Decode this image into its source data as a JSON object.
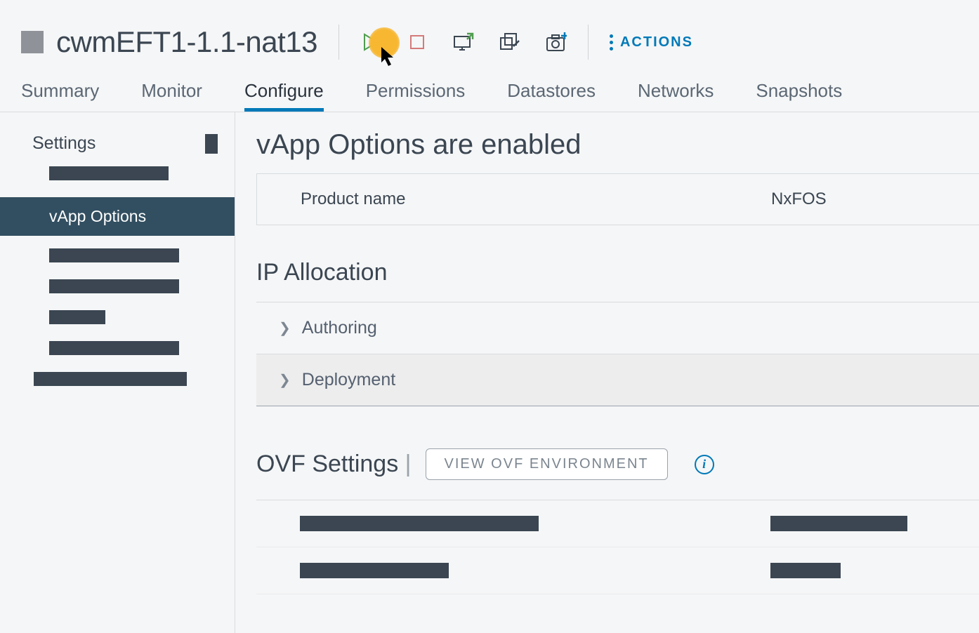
{
  "header": {
    "title": "cwmEFT1-1.1-nat13",
    "actions_label": "ACTIONS"
  },
  "tabs": [
    {
      "label": "Summary",
      "active": false
    },
    {
      "label": "Monitor",
      "active": false
    },
    {
      "label": "Configure",
      "active": true
    },
    {
      "label": "Permissions",
      "active": false
    },
    {
      "label": "Datastores",
      "active": false
    },
    {
      "label": "Networks",
      "active": false
    },
    {
      "label": "Snapshots",
      "active": false
    }
  ],
  "sidebar": {
    "heading": "Settings",
    "active_item": "vApp Options"
  },
  "main": {
    "vapp_title": "vApp Options are enabled",
    "product_name_label": "Product name",
    "product_name_value": "NxFOS",
    "ip_allocation_title": "IP Allocation",
    "authoring_label": "Authoring",
    "deployment_label": "Deployment",
    "ovf_title": "OVF Settings",
    "ovf_divider": "|",
    "view_ovf_label": "VIEW OVF ENVIRONMENT"
  }
}
